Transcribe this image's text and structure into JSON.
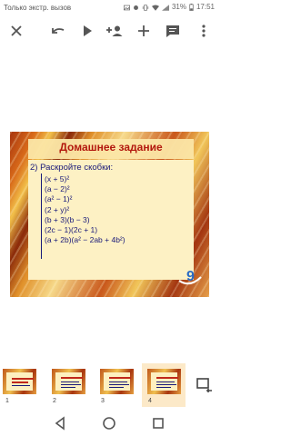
{
  "status_bar": {
    "carrier": "Только экстр. вызов",
    "battery": "31%",
    "time": "17:51"
  },
  "toolbar": {
    "close_icon": "close-icon",
    "undo_icon": "undo-icon",
    "play_icon": "play-icon",
    "add_person_icon": "add-person-icon",
    "add_icon": "add-icon",
    "comment_icon": "comment-icon",
    "more_icon": "more-vertical-icon"
  },
  "slide": {
    "title": "Домашнее задание",
    "task": "2) Раскройте скобки:",
    "expressions": [
      "(x + 5)²",
      "(a − 2)²",
      "(a² − 1)²",
      "(2 + y)²",
      "(b + 3)(b − 3)",
      "(2c − 1)(2c + 1)",
      "(a + 2b)(a² − 2ab + 4b²)"
    ],
    "badge": "9"
  },
  "thumbnails": [
    {
      "number": "1"
    },
    {
      "number": "2"
    },
    {
      "number": "3"
    },
    {
      "number": "4",
      "selected": true
    }
  ],
  "colors": {
    "title_red": "#b3180e",
    "text_navy": "#1a1a7a",
    "selected_thumb_bg": "#fce9c8"
  }
}
